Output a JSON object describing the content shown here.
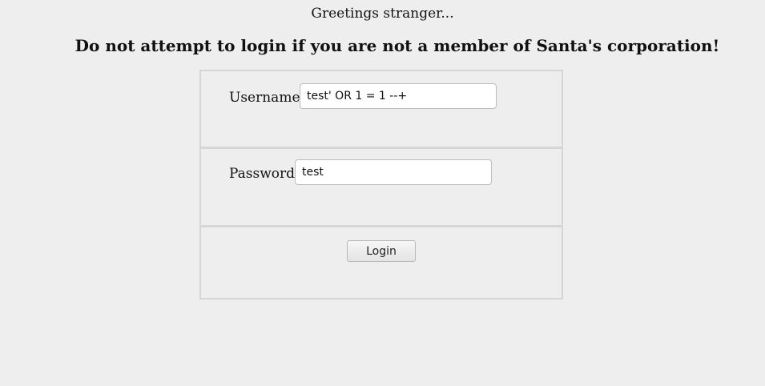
{
  "header": {
    "greeting": "Greetings stranger...",
    "warning": "Do not attempt to login if you are not a member of Santa's corporation!"
  },
  "form": {
    "username": {
      "label": "Username",
      "value": "test' OR 1 = 1 --+"
    },
    "password": {
      "label": "Password",
      "value": "test"
    },
    "login_label": "Login"
  }
}
